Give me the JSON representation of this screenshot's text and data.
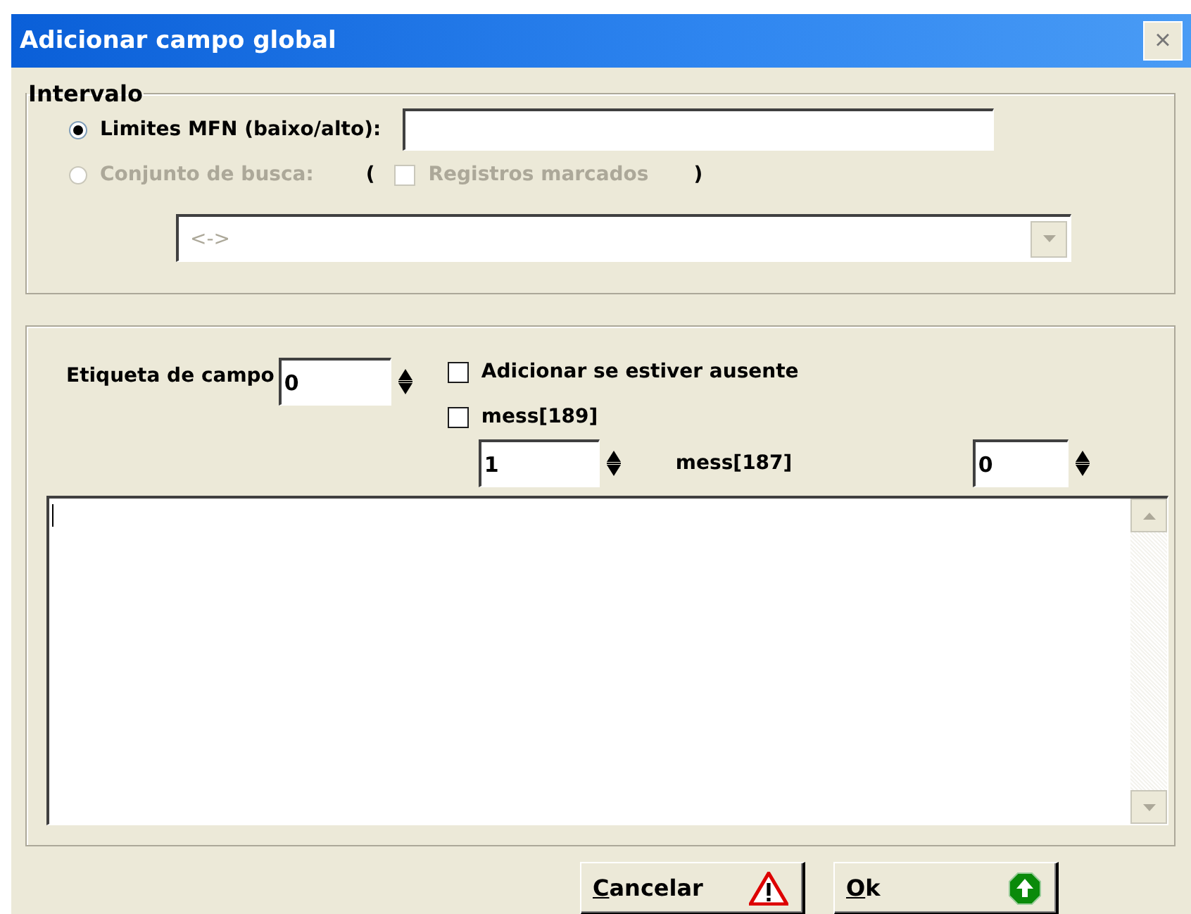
{
  "window": {
    "title": "Adicionar campo global",
    "close": "×"
  },
  "intervalo": {
    "title": "Intervalo",
    "options": [
      {
        "label": "Limites MFN (baixo/alto):",
        "selected": true,
        "disabled": false
      },
      {
        "label": "Conjunto de busca:",
        "selected": false,
        "disabled": true
      }
    ],
    "paren_open": "(",
    "paren_close": ")",
    "marked": {
      "label": "Registros marcados",
      "checked": false,
      "disabled": true
    },
    "search_set": {
      "value": "<->",
      "disabled": true
    }
  },
  "field": {
    "tag_label": "Etiqueta de campo",
    "tag_value": "0",
    "checks": [
      {
        "label": "Adicionar se estiver ausente",
        "checked": false
      },
      {
        "label": "mess[189]",
        "checked": false
      }
    ],
    "occ_from": "1",
    "occ_label": "mess[187]",
    "occ_to": "0"
  },
  "buttons": [
    {
      "label": "Cancelar",
      "underline_first": true,
      "kind": "cancel"
    },
    {
      "label": "Ok",
      "underline_first": true,
      "kind": "ok"
    }
  ]
}
